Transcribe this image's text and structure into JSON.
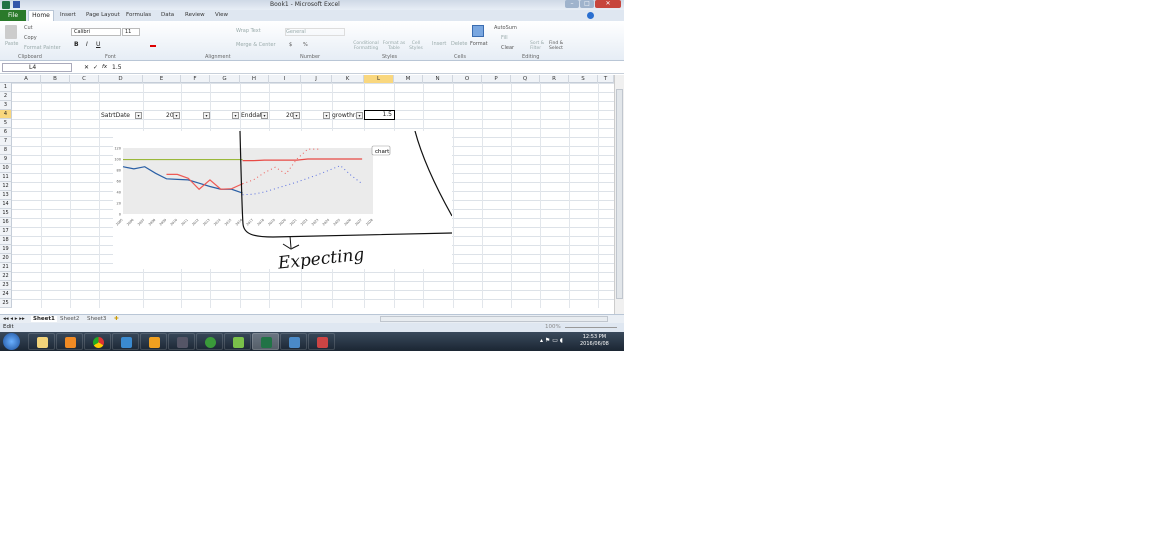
{
  "window": {
    "title": "Book1 - Microsoft Excel",
    "min": "–",
    "max": "□",
    "close": "✕"
  },
  "ribbon": {
    "file_tab": "File",
    "tabs": [
      "Home",
      "Insert",
      "Page Layout",
      "Formulas",
      "Data",
      "Review",
      "View"
    ],
    "clipboard": {
      "paste": "Paste",
      "cut": "Cut",
      "copy": "Copy",
      "format_painter": "Format Painter",
      "label": "Clipboard"
    },
    "font": {
      "name": "Calibri",
      "size": "11",
      "label": "Font",
      "bold": "B",
      "italic": "I",
      "underline": "U"
    },
    "alignment": {
      "wrap": "Wrap Text",
      "merge": "Merge & Center",
      "label": "Alignment"
    },
    "number": {
      "format": "General",
      "currency": "$",
      "percent": "%",
      "label": "Number"
    },
    "styles": {
      "conditional": "Conditional Formatting",
      "format_table": "Format as Table",
      "cell_styles": "Cell Styles",
      "label": "Styles"
    },
    "cells": {
      "insert": "Insert",
      "delete": "Delete",
      "format": "Format",
      "label": "Cells"
    },
    "editing": {
      "autosum": "AutoSum",
      "fill": "Fill",
      "clear": "Clear",
      "sort": "Sort & Filter",
      "find": "Find & Select",
      "label": "Editing"
    }
  },
  "formula_bar": {
    "name_box": "L4",
    "fx": "fx",
    "value": "1.5"
  },
  "columns": [
    "A",
    "B",
    "C",
    "D",
    "E",
    "F",
    "G",
    "H",
    "I",
    "J",
    "K",
    "L",
    "M",
    "N",
    "O",
    "P",
    "Q",
    "R",
    "S",
    "T"
  ],
  "selected_column": "L",
  "rows": [
    "1",
    "2",
    "3",
    "4",
    "5",
    "6",
    "7",
    "8",
    "9",
    "10",
    "11",
    "12",
    "13",
    "14",
    "15",
    "16",
    "17",
    "18",
    "19",
    "20",
    "21",
    "22",
    "23",
    "24",
    "25"
  ],
  "cells": {
    "D4": "SatrtDate",
    "E4": "20",
    "H4": "Enddat",
    "I4": "20",
    "K4": "growthra",
    "L4": "1.5"
  },
  "chart_data": {
    "type": "line",
    "button": "chart",
    "y_ticks": [
      "120",
      "100",
      "80",
      "60",
      "40",
      "20",
      "0"
    ],
    "ylim": [
      0,
      120
    ],
    "x": [
      2005,
      2006,
      2007,
      2008,
      2009,
      2010,
      2011,
      2012,
      2013,
      2014,
      2015,
      2016,
      2017,
      2018,
      2019,
      2020,
      2021,
      2022,
      2023,
      2024,
      2025,
      2026,
      2027,
      2028
    ],
    "series": [
      {
        "color": "#2a5fa5",
        "style": "solid",
        "x0": 2005,
        "values": [
          86,
          82,
          86,
          74,
          64,
          63,
          62,
          56,
          50,
          45,
          45,
          38
        ]
      },
      {
        "color": "#5a6fe0",
        "style": "dotted",
        "x0": 2016,
        "values": [
          35,
          36,
          40,
          46,
          52,
          58,
          65,
          72,
          80,
          88,
          70,
          55
        ]
      },
      {
        "color": "#ee5a55",
        "style": "solid",
        "x0": 2009,
        "values": [
          72,
          72,
          65,
          45,
          62,
          45,
          46,
          55
        ]
      },
      {
        "color": "#ee5a55",
        "style": "dotted",
        "x0": 2016,
        "values": [
          55,
          62,
          75,
          85,
          73,
          100,
          118,
          118
        ]
      },
      {
        "color": "#9ab83a",
        "style": "solid",
        "x0": 2005,
        "values": [
          99,
          99,
          99,
          99,
          99,
          99,
          99,
          99,
          99,
          99,
          99,
          99
        ]
      },
      {
        "color": "#e84a45",
        "style": "solid",
        "x0": 2016,
        "values": [
          97,
          97,
          98,
          98,
          98,
          98,
          100,
          100,
          100,
          100,
          100,
          100
        ]
      }
    ],
    "annotation": "Expecting"
  },
  "sheets": [
    "Sheet1",
    "Sheet2",
    "Sheet3"
  ],
  "status": {
    "mode": "Edit",
    "zoom": "100%"
  },
  "taskbar": {
    "time": "12:53 PM",
    "date": "2016/06/08"
  },
  "colors": {
    "accent": "#2a7a2a",
    "selection": "#f9d77e"
  }
}
